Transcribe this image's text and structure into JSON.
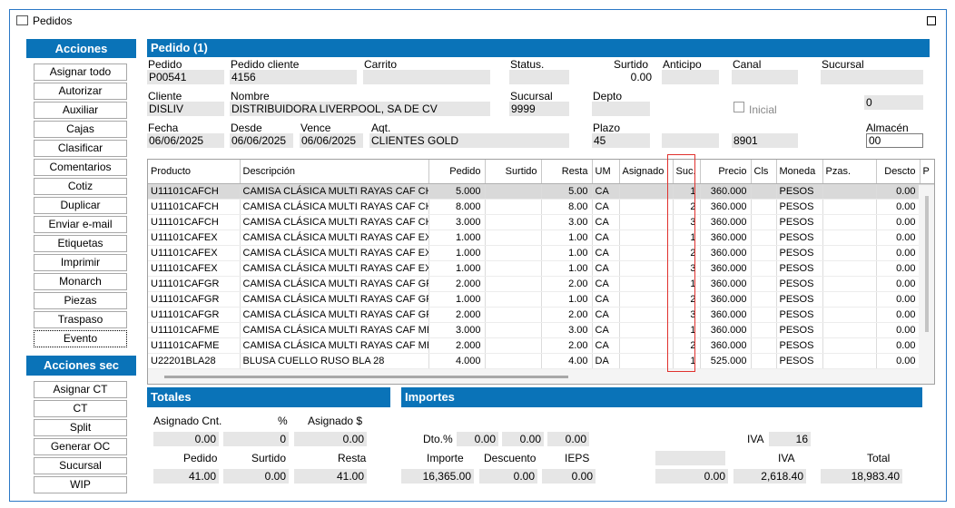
{
  "window": {
    "title": "Pedidos"
  },
  "acciones": {
    "header": "Acciones",
    "buttons": [
      "Asignar todo",
      "Autorizar",
      "Auxiliar",
      "Cajas",
      "Clasificar",
      "Comentarios",
      "Cotiz",
      "Duplicar",
      "Enviar e-mail",
      "Etiquetas",
      "Imprimir",
      "Monarch",
      "Piezas",
      "Traspaso",
      "Evento"
    ]
  },
  "acciones_sec": {
    "header": "Acciones sec",
    "buttons": [
      "Asignar CT",
      "CT",
      "Split",
      "Generar OC",
      "Sucursal",
      "WIP"
    ]
  },
  "pedido": {
    "header": "Pedido (1)",
    "labels": {
      "pedido": "Pedido",
      "pedido_cliente": "Pedido cliente",
      "carrito": "Carrito",
      "status": "Status.",
      "surtido": "Surtido",
      "anticipo": "Anticipo",
      "canal": "Canal",
      "sucursal_top": "Sucursal",
      "cliente": "Cliente",
      "nombre": "Nombre",
      "sucursal": "Sucursal",
      "depto": "Depto",
      "inicial": "Inicial",
      "fecha": "Fecha",
      "desde": "Desde",
      "vence": "Vence",
      "aqt": "Aqt.",
      "plazo": "Plazo",
      "almacen": "Almacén"
    },
    "values": {
      "pedido": "P00541",
      "pedido_cliente": "4156",
      "surtido": "0.00",
      "cliente": "DISLIV",
      "nombre": "DISTRIBUIDORA LIVERPOOL, SA DE CV",
      "sucursal": "9999",
      "right_zero": "0",
      "fecha": "06/06/2025",
      "desde": "06/06/2025",
      "vence": "06/06/2025",
      "aqt": "CLIENTES GOLD",
      "plazo": "45",
      "code": "8901",
      "almacen": "00"
    }
  },
  "grid": {
    "columns": [
      "Producto",
      "Descripción",
      "Pedido",
      "Surtido",
      "Resta",
      "UM",
      "Asignado",
      "Suc.",
      "Precio",
      "Cls",
      "Moneda",
      "Pzas.",
      "Descto",
      "P"
    ],
    "rows": [
      [
        "U11101CAFCH",
        "CAMISA CLÁSICA MULTI RAYAS CAF CH",
        "5.000",
        "",
        "5.00",
        "CA",
        "",
        "1",
        "360.000",
        "",
        "PESOS",
        "",
        "0.00"
      ],
      [
        "U11101CAFCH",
        "CAMISA CLÁSICA MULTI RAYAS CAF CH",
        "8.000",
        "",
        "8.00",
        "CA",
        "",
        "2",
        "360.000",
        "",
        "PESOS",
        "",
        "0.00"
      ],
      [
        "U11101CAFCH",
        "CAMISA CLÁSICA MULTI RAYAS CAF CH",
        "3.000",
        "",
        "3.00",
        "CA",
        "",
        "3",
        "360.000",
        "",
        "PESOS",
        "",
        "0.00"
      ],
      [
        "U11101CAFEX",
        "CAMISA CLÁSICA MULTI RAYAS CAF EX",
        "1.000",
        "",
        "1.00",
        "CA",
        "",
        "1",
        "360.000",
        "",
        "PESOS",
        "",
        "0.00"
      ],
      [
        "U11101CAFEX",
        "CAMISA CLÁSICA MULTI RAYAS CAF EX",
        "1.000",
        "",
        "1.00",
        "CA",
        "",
        "2",
        "360.000",
        "",
        "PESOS",
        "",
        "0.00"
      ],
      [
        "U11101CAFEX",
        "CAMISA CLÁSICA MULTI RAYAS CAF EX",
        "1.000",
        "",
        "1.00",
        "CA",
        "",
        "3",
        "360.000",
        "",
        "PESOS",
        "",
        "0.00"
      ],
      [
        "U11101CAFGR",
        "CAMISA CLÁSICA MULTI RAYAS CAF GR",
        "2.000",
        "",
        "2.00",
        "CA",
        "",
        "1",
        "360.000",
        "",
        "PESOS",
        "",
        "0.00"
      ],
      [
        "U11101CAFGR",
        "CAMISA CLÁSICA MULTI RAYAS CAF GR",
        "1.000",
        "",
        "1.00",
        "CA",
        "",
        "2",
        "360.000",
        "",
        "PESOS",
        "",
        "0.00"
      ],
      [
        "U11101CAFGR",
        "CAMISA CLÁSICA MULTI RAYAS CAF GR",
        "2.000",
        "",
        "2.00",
        "CA",
        "",
        "3",
        "360.000",
        "",
        "PESOS",
        "",
        "0.00"
      ],
      [
        "U11101CAFME",
        "CAMISA CLÁSICA MULTI RAYAS CAF ME",
        "3.000",
        "",
        "3.00",
        "CA",
        "",
        "1",
        "360.000",
        "",
        "PESOS",
        "",
        "0.00"
      ],
      [
        "U11101CAFME",
        "CAMISA CLÁSICA MULTI RAYAS CAF ME",
        "2.000",
        "",
        "2.00",
        "CA",
        "",
        "2",
        "360.000",
        "",
        "PESOS",
        "",
        "0.00"
      ],
      [
        "U22201BLA28",
        "BLUSA CUELLO RUSO BLA 28",
        "4.000",
        "",
        "4.00",
        "DA",
        "",
        "1",
        "525.000",
        "",
        "PESOS",
        "",
        "0.00"
      ]
    ]
  },
  "totales": {
    "header": "Totales",
    "asignado_cnt_label": "Asignado Cnt.",
    "pct_label": "%",
    "asignado_money_label": "Asignado $",
    "asignado_cnt": "0.00",
    "pct": "0",
    "asignado_money": "0.00",
    "pedido_label": "Pedido",
    "surtido_label": "Surtido",
    "resta_label": "Resta",
    "pedido": "41.00",
    "surtido": "0.00",
    "resta": "41.00"
  },
  "importes": {
    "header": "Importes",
    "dto_label": "Dto.%",
    "dto1": "0.00",
    "dto2": "0.00",
    "dto3": "0.00",
    "iva_pct_label": "IVA",
    "iva_pct": "16",
    "importe_label": "Importe",
    "descuento_label": "Descuento",
    "ieps_label": "IEPS",
    "iva_label": "IVA",
    "total_label": "Total",
    "importe": "16,365.00",
    "descuento": "0.00",
    "ieps": "0.00",
    "extra": "0.00",
    "iva": "2,618.40",
    "total": "18,983.40"
  },
  "colors": {
    "accent": "#0a73b8",
    "highlight_box": "#e0312d",
    "field_bg": "#e6e6e6",
    "selected_row": "#d9d9d9"
  }
}
